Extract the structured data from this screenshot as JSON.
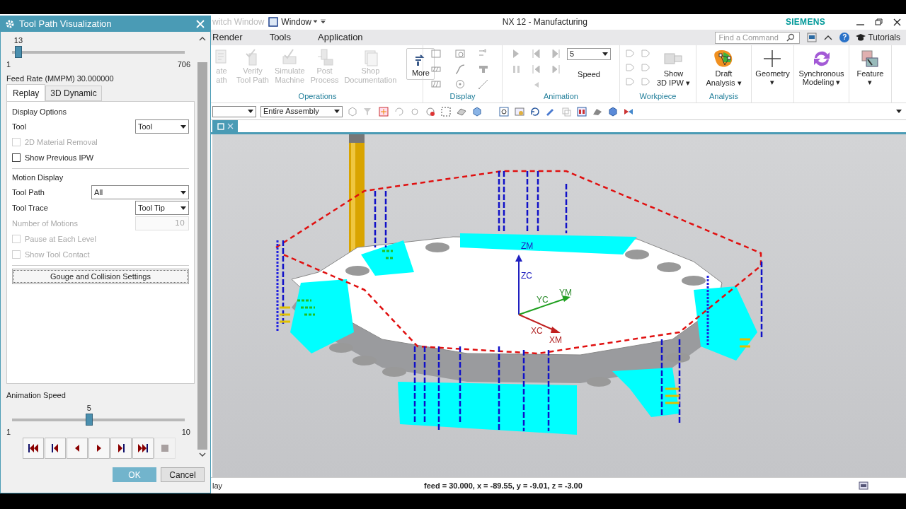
{
  "window": {
    "quick_access": [
      "witch Window",
      "Window"
    ],
    "title": "NX 12 - Manufacturing",
    "brand": "SIEMENS"
  },
  "menu": [
    {
      "label": "Render"
    },
    {
      "label": "Tools"
    },
    {
      "label": "Application"
    }
  ],
  "command_search": {
    "placeholder": "Find a Command"
  },
  "help_button": "?",
  "help_link": "Tutorials",
  "ribbon": {
    "operations": {
      "label": "Operations",
      "items": [
        {
          "label": "ate\nath",
          "disabled": true
        },
        {
          "label": "Verify\nTool Path",
          "disabled": true
        },
        {
          "label": "Simulate\nMachine",
          "disabled": true
        },
        {
          "label": "Post\nProcess",
          "disabled": true
        },
        {
          "label": "Shop\nDocumentation",
          "disabled": true
        },
        {
          "label": "More",
          "disabled": false
        }
      ]
    },
    "display": {
      "label": "Display"
    },
    "animation": {
      "label": "Animation",
      "speed_value": "5",
      "speed_label": "Speed"
    },
    "workpiece": {
      "label": "Workpiece",
      "button": "Show\n3D IPW ▾"
    },
    "analysis": {
      "label": "Analysis",
      "button": "Draft\nAnalysis ▾"
    },
    "standalone": [
      {
        "label": "Geometry\n▾"
      },
      {
        "label": "Synchronous\nModeling ▾"
      },
      {
        "label": "Feature\n▾"
      }
    ]
  },
  "selection_bar": {
    "scope_value": "Entire Assembly"
  },
  "viewport": {
    "axis_labels": [
      "ZM",
      "ZC",
      "YC",
      "YM",
      "XC",
      "XM"
    ]
  },
  "status_bar": {
    "left": "lay",
    "readout": "feed = 30.000, x = -89.55, y = -9.01, z = -3.00"
  },
  "dialog": {
    "title": "Tool Path Visualization",
    "motion_slider": {
      "value": "13",
      "min": "1",
      "max": "706",
      "level": 0.017
    },
    "feed_rate": "Feed Rate (MMPM) 30.000000",
    "tabs": [
      {
        "label": "Replay",
        "selected": true
      },
      {
        "label": "3D Dynamic",
        "selected": false
      }
    ],
    "sections": [
      {
        "heading": "Display Options",
        "rows": [
          {
            "kind": "select",
            "label": "Tool",
            "value": "Tool",
            "disabled": false
          },
          {
            "kind": "checkbox",
            "label": "2D Material Removal",
            "checked": false,
            "disabled": true
          },
          {
            "kind": "checkbox",
            "label": "Show Previous IPW",
            "checked": false,
            "disabled": false
          }
        ]
      },
      {
        "heading": "Motion Display",
        "rows": [
          {
            "kind": "combo",
            "label": "Tool Path",
            "value": "All",
            "disabled": false
          },
          {
            "kind": "select",
            "label": "Tool Trace",
            "value": "Tool Tip",
            "disabled": false
          },
          {
            "kind": "number",
            "label": "Number of Motions",
            "value": "10",
            "disabled": true
          },
          {
            "kind": "checkbox",
            "label": "Pause at Each Level",
            "checked": false,
            "disabled": true
          },
          {
            "kind": "checkbox",
            "label": "Show Tool Contact",
            "checked": false,
            "disabled": true
          }
        ]
      }
    ],
    "settings_button": "Gouge and Collision Settings",
    "animation_speed": {
      "label": "Animation Speed",
      "value": "5",
      "min": "1",
      "max": "10",
      "level": 0.444
    },
    "playback": [
      {
        "kind": "first",
        "disabled": false
      },
      {
        "kind": "step-back",
        "disabled": false
      },
      {
        "kind": "reverse",
        "disabled": false
      },
      {
        "kind": "play",
        "disabled": false
      },
      {
        "kind": "step-forward",
        "disabled": false
      },
      {
        "kind": "last",
        "disabled": false
      },
      {
        "kind": "stop",
        "disabled": true
      }
    ],
    "buttons": [
      {
        "label": "OK",
        "primary": true
      },
      {
        "label": "Cancel",
        "primary": false
      }
    ]
  }
}
